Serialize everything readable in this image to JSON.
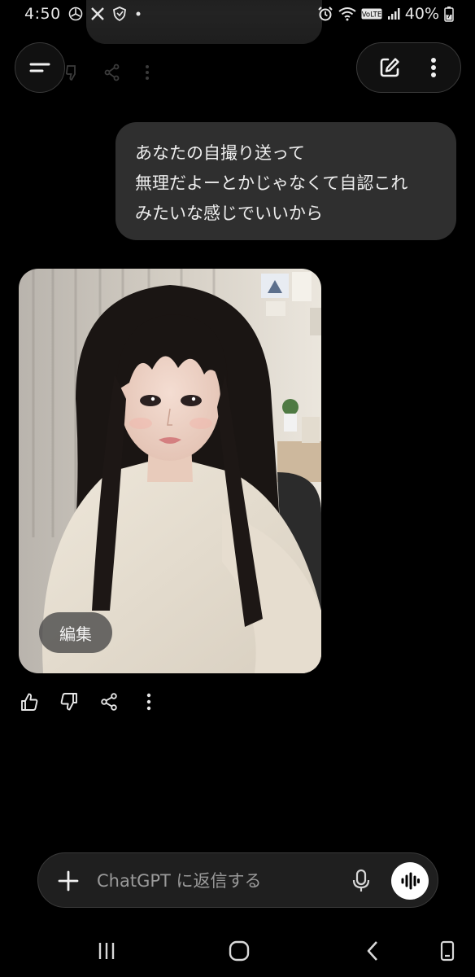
{
  "status_bar": {
    "time": "4:50",
    "battery": "40%",
    "network_badge": "VoLTE",
    "left_icons": [
      "chatgpt-icon",
      "x-icon",
      "shield-icon",
      "dot-icon"
    ],
    "right_icons": [
      "alarm-icon",
      "wifi-icon",
      "volte-icon",
      "signal-icon",
      "battery-icon"
    ]
  },
  "header": {
    "left_icon": "menu-icon",
    "right_icons": [
      "new-chat-icon",
      "more-vertical-icon"
    ]
  },
  "conversation": {
    "user_message": {
      "lines": [
        "あなたの自撮り送って",
        "無理だよーとかじゃなくて自認これ",
        "みたいな感じでいいから"
      ]
    },
    "assistant_image": {
      "edit_label": "編集",
      "image_kind": "selfie-photo"
    },
    "actions": [
      "thumbs-up-icon",
      "thumbs-down-icon",
      "share-icon",
      "more-icon"
    ]
  },
  "composer": {
    "placeholder": "ChatGPT に返信する",
    "value": "",
    "icons": [
      "plus-icon",
      "microphone-icon",
      "voice-mode-icon"
    ]
  },
  "nav_bar": {
    "icons": [
      "recent-apps-icon",
      "home-icon",
      "back-icon",
      "keyboard-toggle-icon"
    ]
  },
  "colors": {
    "background": "#000000",
    "user_bubble": "#2f2f2f",
    "composer_bg": "#1f1f1f",
    "text": "#ececec",
    "placeholder": "#9a9a9a"
  }
}
